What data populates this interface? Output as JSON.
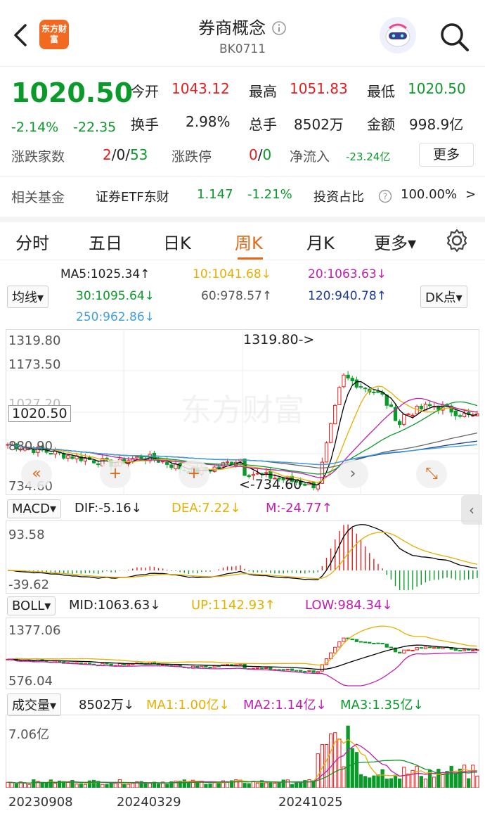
{
  "header": {
    "title": "券商概念",
    "code": "BK0711",
    "app_logo_text": "东方财富",
    "icons": [
      "back-icon",
      "info-icon",
      "robot-avatar-icon",
      "search-icon"
    ]
  },
  "quote": {
    "price": "1020.50",
    "change_pct": "-2.14%",
    "change": "-22.35",
    "open_label": "今开",
    "open": "1043.12",
    "high_label": "最高",
    "high": "1051.83",
    "low_label": "最低",
    "low": "1020.50",
    "turnover_label": "换手",
    "turnover": "2.98%",
    "volume_label": "总手",
    "volume": "8502万",
    "amount_label": "金额",
    "amount": "998.9亿",
    "breadth_label": "涨跌家数",
    "breadth_up": "2",
    "breadth_flat": "/0/",
    "breadth_down": "53",
    "limit_label": "涨跌停",
    "limit_up": "0",
    "limit_sep": "/",
    "limit_down": "0",
    "netflow_label": "净流入",
    "netflow": "-23.24亿",
    "more_button": "更多"
  },
  "fund": {
    "label": "相关基金",
    "name": "证券ETF东财",
    "price": "1.147",
    "change_pct": "-1.21%",
    "ratio_label": "投资占比",
    "ratio": "100.00%",
    "arrow": ">"
  },
  "tabs": [
    {
      "label": "分时"
    },
    {
      "label": "五日"
    },
    {
      "label": "日K"
    },
    {
      "label": "周K",
      "active": true
    },
    {
      "label": "月K"
    },
    {
      "label": "更多▾"
    }
  ],
  "ma_legend": {
    "selector": "均线▾",
    "ma5": "MA5:1025.34↑",
    "ma10": "10:1041.68↓",
    "ma20": "20:1063.63↓",
    "ma30": "30:1095.64↓",
    "ma60": "60:978.57↑",
    "ma120": "120:940.78↑",
    "ma250": "250:962.86↓",
    "dk_button": "DK点▾"
  },
  "kline": {
    "axis_top": "1319.80",
    "axis_2": "1173.50",
    "axis_3": "1027.20",
    "axis_4": "880.90",
    "axis_bottom": "734.60",
    "current_tag": "1020.50",
    "max_annotation": "1319.80->",
    "min_annotation": "<-734.60",
    "watermark": "东方财富",
    "nav": [
      "«",
      "+",
      "+",
      "›",
      "⤡"
    ]
  },
  "macd": {
    "selector": "MACD▾",
    "dif": "DIF:-5.16↓",
    "dea": "DEA:7.22↓",
    "m": "M:-24.77↑",
    "axis_top": "93.58",
    "axis_bottom": "-39.62"
  },
  "boll": {
    "selector": "BOLL▾",
    "mid": "MID:1063.63↓",
    "up": "UP:1142.93↑",
    "low": "LOW:984.34↓",
    "axis_top": "1377.06",
    "axis_bottom": "576.04"
  },
  "volume": {
    "selector": "成交量▾",
    "vol": "8502万↓",
    "ma1": "MA1:1.00亿↓",
    "ma2": "MA2:1.14亿↓",
    "ma3": "MA3:1.35亿↓",
    "axis_top": "7.06亿"
  },
  "dates": [
    "20230908",
    "20240329",
    "20241025"
  ],
  "colors": {
    "up": "#e02020",
    "down": "#0a9a2a",
    "accent": "#e06a1a",
    "ma5": "#000000",
    "ma10": "#e6b000",
    "ma20": "#c020b0",
    "ma30": "#0a9a2a",
    "ma60": "#666666",
    "ma120": "#1a3a9a",
    "ma250": "#40a0e0"
  }
}
